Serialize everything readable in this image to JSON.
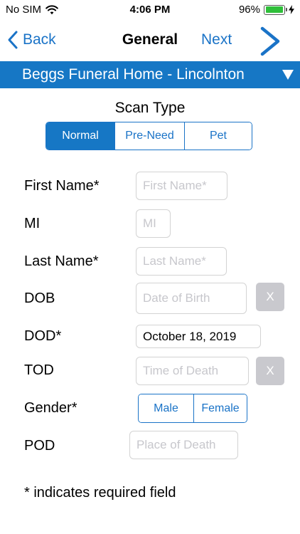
{
  "status_bar": {
    "carrier": "No SIM",
    "time": "4:06 PM",
    "battery_percent": "96%",
    "battery_level": 0.96,
    "icons": [
      "wifi-icon",
      "battery-icon",
      "charging-bolt-icon"
    ],
    "battery_color": "#2fbf3a"
  },
  "nav": {
    "back_label": "Back",
    "title": "General",
    "next_label": "Next",
    "accent_color": "#1a73c7"
  },
  "location": {
    "name": "Beggs Funeral Home - Lincolnton",
    "background_color": "#1677c5"
  },
  "scan_type": {
    "label": "Scan Type",
    "options": [
      "Normal",
      "Pre-Need",
      "Pet"
    ],
    "selected": "Normal"
  },
  "form": {
    "first_name": {
      "label": "First Name*",
      "placeholder": "First Name*",
      "value": ""
    },
    "mi": {
      "label": "MI",
      "placeholder": "MI",
      "value": ""
    },
    "last_name": {
      "label": "Last Name*",
      "placeholder": "Last Name*",
      "value": ""
    },
    "dob": {
      "label": "DOB",
      "placeholder": "Date of Birth",
      "value": "",
      "clear_label": "X"
    },
    "dod": {
      "label": "DOD*",
      "placeholder": "",
      "value": "October 18, 2019"
    },
    "tod": {
      "label": "TOD",
      "placeholder": "Time of Death",
      "value": "",
      "clear_label": "X"
    },
    "gender": {
      "label": "Gender*",
      "options": [
        "Male",
        "Female"
      ],
      "selected": ""
    },
    "pod": {
      "label": "POD",
      "placeholder": "Place of Death",
      "value": ""
    }
  },
  "required_note": "* indicates required field"
}
